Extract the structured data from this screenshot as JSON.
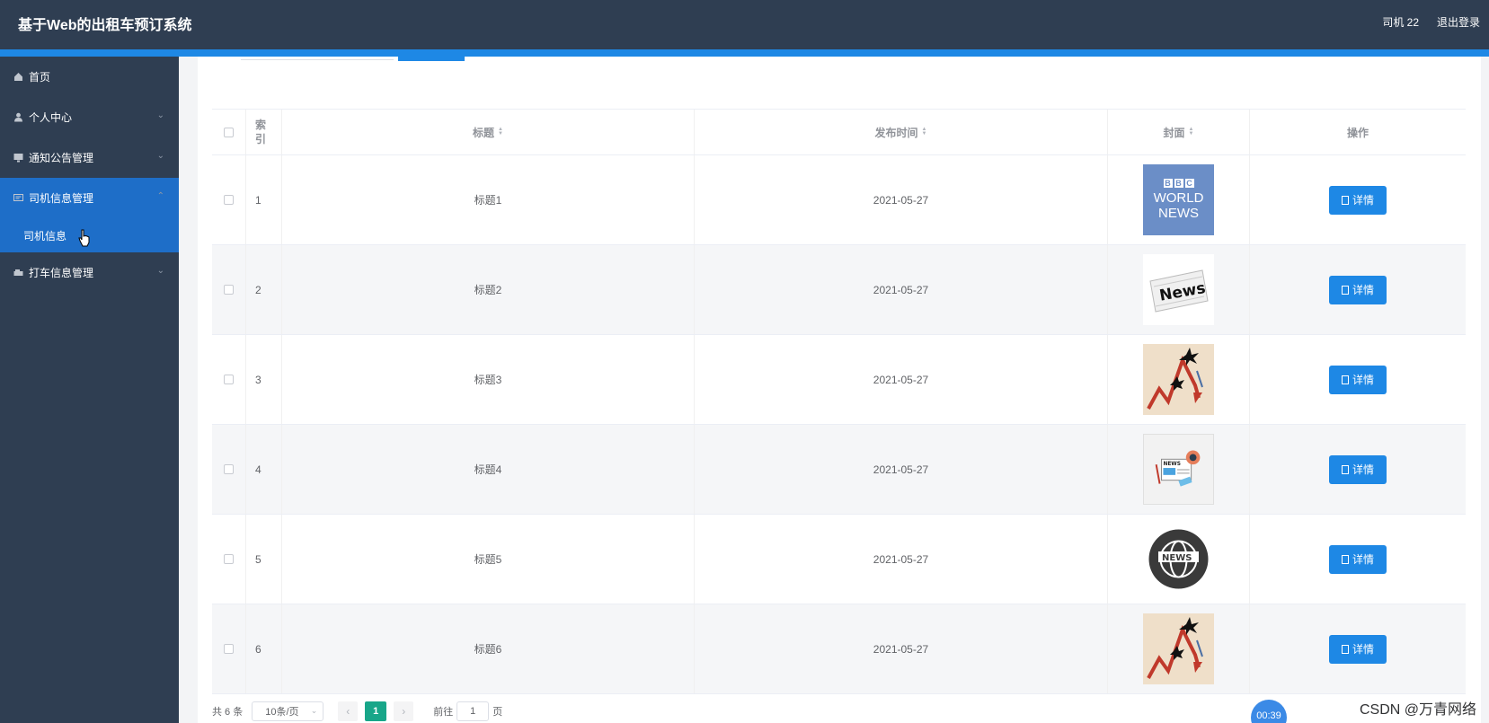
{
  "header": {
    "title": "基于Web的出租车预订系统",
    "user": "司机 22",
    "logout": "退出登录"
  },
  "sidebar": {
    "items": [
      {
        "label": "首页",
        "icon": "home-icon"
      },
      {
        "label": "个人中心",
        "icon": "user-icon"
      },
      {
        "label": "通知公告管理",
        "icon": "monitor-icon"
      },
      {
        "label": "司机信息管理",
        "icon": "message-icon",
        "active": true
      },
      {
        "label": "打车信息管理",
        "icon": "car-icon"
      }
    ],
    "submenu": {
      "label": "司机信息"
    }
  },
  "table": {
    "headers": {
      "index": "索引",
      "title": "标题",
      "time": "发布时间",
      "cover": "封面",
      "op": "操作"
    },
    "rows": [
      {
        "index": "1",
        "title": "标题1",
        "time": "2021-05-27",
        "cover": "bbc-world-news-image",
        "action": "详情"
      },
      {
        "index": "2",
        "title": "标题2",
        "time": "2021-05-27",
        "cover": "newspaper-news-image",
        "action": "详情"
      },
      {
        "index": "3",
        "title": "标题3",
        "time": "2021-05-27",
        "cover": "falling-chart-image",
        "action": "详情"
      },
      {
        "index": "4",
        "title": "标题4",
        "time": "2021-05-27",
        "cover": "news-illustration-image",
        "action": "详情"
      },
      {
        "index": "5",
        "title": "标题5",
        "time": "2021-05-27",
        "cover": "news-globe-image",
        "action": "详情"
      },
      {
        "index": "6",
        "title": "标题6",
        "time": "2021-05-27",
        "cover": "falling-chart-image",
        "action": "详情"
      }
    ]
  },
  "pagination": {
    "total": "共 6 条",
    "page_size": "10条/页",
    "current": "1",
    "goto_label": "前往",
    "goto_value": "1",
    "page_unit": "页"
  },
  "overlay": {
    "timer": "00:39",
    "watermark": "CSDN @万青网络"
  },
  "colors": {
    "header_bg": "#2f3e52",
    "accent": "#1e88e5",
    "active_menu": "#1e6ec8",
    "page_active": "#18a689"
  }
}
